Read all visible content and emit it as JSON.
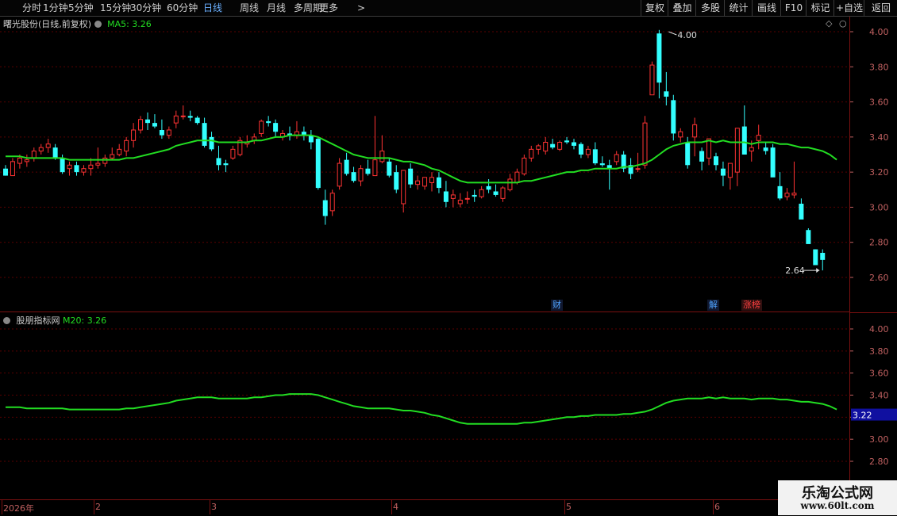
{
  "toolbar": {
    "periods": [
      "分时",
      "1分钟",
      "5分钟",
      "15分钟",
      "30分钟",
      "60分钟",
      "日线",
      "周线",
      "月线",
      "多周期",
      "更多"
    ],
    "active_period": "日线",
    "more_arrow": ">",
    "buttons": [
      "复权",
      "叠加",
      "多股",
      "统计",
      "画线",
      "F10",
      "标记",
      "+自选",
      "返回"
    ]
  },
  "main_header": {
    "title": "曙光股份(日线,前复权)",
    "ma_label": "MA5: 3.26"
  },
  "indicator_header": {
    "title": "股朋指标网",
    "ma_label": "M20: 3.26"
  },
  "annotations": {
    "high_label": "4.00",
    "low_label": "2.64",
    "current_value": "3.22"
  },
  "events": [
    {
      "text": "财",
      "color": "#4fa3ff",
      "bg": "#101830"
    },
    {
      "text": "解",
      "color": "#4fa3ff",
      "bg": "#101830"
    },
    {
      "text": "涨榜",
      "color": "#ff4040",
      "bg": "#301010"
    }
  ],
  "time_axis": [
    "2026年",
    "2",
    "3",
    "4",
    "5",
    "6"
  ],
  "watermark": {
    "name": "乐淘公式网",
    "url": "www.60lt.com"
  },
  "colors": {
    "up": "#ff3333",
    "down": "#33ffff",
    "ma": "#22dd22",
    "grid": "#5a0000"
  },
  "chart_data": [
    {
      "type": "candlestick",
      "title": "曙光股份(日线,前复权)",
      "y_ticks": [
        "4.00",
        "3.80",
        "3.60",
        "3.40",
        "3.20",
        "3.00",
        "2.80",
        "2.60"
      ],
      "ylim": [
        2.52,
        4.06
      ],
      "candles": [
        [
          3.22,
          3.24,
          3.18,
          3.18
        ],
        [
          3.18,
          3.28,
          3.18,
          3.26
        ],
        [
          3.25,
          3.3,
          3.22,
          3.28
        ],
        [
          3.26,
          3.3,
          3.23,
          3.27
        ],
        [
          3.28,
          3.34,
          3.26,
          3.32
        ],
        [
          3.32,
          3.36,
          3.3,
          3.34
        ],
        [
          3.34,
          3.39,
          3.31,
          3.36
        ],
        [
          3.34,
          3.36,
          3.27,
          3.28
        ],
        [
          3.28,
          3.3,
          3.19,
          3.2
        ],
        [
          3.22,
          3.26,
          3.18,
          3.24
        ],
        [
          3.24,
          3.26,
          3.18,
          3.2
        ],
        [
          3.2,
          3.24,
          3.18,
          3.22
        ],
        [
          3.22,
          3.28,
          3.18,
          3.24
        ],
        [
          3.24,
          3.34,
          3.22,
          3.25
        ],
        [
          3.25,
          3.3,
          3.23,
          3.28
        ],
        [
          3.28,
          3.34,
          3.27,
          3.3
        ],
        [
          3.3,
          3.36,
          3.29,
          3.33
        ],
        [
          3.32,
          3.4,
          3.29,
          3.38
        ],
        [
          3.38,
          3.48,
          3.34,
          3.44
        ],
        [
          3.44,
          3.52,
          3.42,
          3.5
        ],
        [
          3.5,
          3.54,
          3.44,
          3.48
        ],
        [
          3.48,
          3.53,
          3.45,
          3.46
        ],
        [
          3.44,
          3.5,
          3.39,
          3.41
        ],
        [
          3.41,
          3.46,
          3.39,
          3.44
        ],
        [
          3.48,
          3.55,
          3.45,
          3.52
        ],
        [
          3.52,
          3.58,
          3.5,
          3.52
        ],
        [
          3.52,
          3.55,
          3.49,
          3.51
        ],
        [
          3.51,
          3.52,
          3.47,
          3.48
        ],
        [
          3.48,
          3.51,
          3.34,
          3.35
        ],
        [
          3.4,
          3.43,
          3.32,
          3.33
        ],
        [
          3.28,
          3.35,
          3.21,
          3.24
        ],
        [
          3.25,
          3.27,
          3.2,
          3.24
        ],
        [
          3.28,
          3.35,
          3.27,
          3.33
        ],
        [
          3.3,
          3.4,
          3.29,
          3.38
        ],
        [
          3.36,
          3.41,
          3.34,
          3.37
        ],
        [
          3.38,
          3.42,
          3.36,
          3.4
        ],
        [
          3.42,
          3.5,
          3.4,
          3.49
        ],
        [
          3.49,
          3.52,
          3.46,
          3.48
        ],
        [
          3.48,
          3.5,
          3.4,
          3.43
        ],
        [
          3.4,
          3.44,
          3.38,
          3.42
        ],
        [
          3.42,
          3.46,
          3.38,
          3.41
        ],
        [
          3.41,
          3.49,
          3.39,
          3.43
        ],
        [
          3.43,
          3.46,
          3.38,
          3.41
        ],
        [
          3.41,
          3.44,
          3.33,
          3.37
        ],
        [
          3.39,
          3.4,
          3.1,
          3.11
        ],
        [
          3.04,
          3.1,
          2.9,
          2.95
        ],
        [
          2.98,
          3.1,
          2.95,
          3.08
        ],
        [
          3.12,
          3.28,
          3.1,
          3.25
        ],
        [
          3.27,
          3.31,
          3.18,
          3.19
        ],
        [
          3.2,
          3.23,
          3.14,
          3.15
        ],
        [
          3.15,
          3.24,
          3.12,
          3.22
        ],
        [
          3.22,
          3.27,
          3.18,
          3.19
        ],
        [
          3.18,
          3.52,
          3.18,
          3.27
        ],
        [
          3.26,
          3.41,
          3.25,
          3.32
        ],
        [
          3.26,
          3.28,
          3.17,
          3.18
        ],
        [
          3.2,
          3.24,
          3.08,
          3.1
        ],
        [
          3.02,
          3.2,
          2.97,
          3.21
        ],
        [
          3.22,
          3.25,
          3.11,
          3.13
        ],
        [
          3.13,
          3.18,
          3.1,
          3.15
        ],
        [
          3.12,
          3.16,
          3.1,
          3.17
        ],
        [
          3.14,
          3.2,
          3.09,
          3.17
        ],
        [
          3.17,
          3.2,
          3.08,
          3.11
        ],
        [
          3.09,
          3.15,
          3.0,
          3.03
        ],
        [
          3.05,
          3.1,
          3.0,
          3.07
        ],
        [
          3.02,
          3.08,
          3.0,
          3.04
        ],
        [
          3.05,
          3.09,
          3.02,
          3.05
        ],
        [
          3.07,
          3.1,
          3.03,
          3.06
        ],
        [
          3.06,
          3.12,
          3.05,
          3.1
        ],
        [
          3.12,
          3.16,
          3.08,
          3.1
        ],
        [
          3.09,
          3.13,
          3.06,
          3.07
        ],
        [
          3.05,
          3.12,
          3.03,
          3.11
        ],
        [
          3.1,
          3.19,
          3.09,
          3.16
        ],
        [
          3.14,
          3.22,
          3.13,
          3.2
        ],
        [
          3.19,
          3.3,
          3.18,
          3.28
        ],
        [
          3.28,
          3.35,
          3.26,
          3.33
        ],
        [
          3.33,
          3.36,
          3.3,
          3.35
        ],
        [
          3.32,
          3.4,
          3.3,
          3.37
        ],
        [
          3.36,
          3.39,
          3.33,
          3.34
        ],
        [
          3.33,
          3.38,
          3.32,
          3.37
        ],
        [
          3.38,
          3.4,
          3.36,
          3.37
        ],
        [
          3.37,
          3.39,
          3.33,
          3.35
        ],
        [
          3.36,
          3.37,
          3.28,
          3.3
        ],
        [
          3.3,
          3.35,
          3.28,
          3.33
        ],
        [
          3.33,
          3.37,
          3.24,
          3.25
        ],
        [
          3.25,
          3.29,
          3.23,
          3.24
        ],
        [
          3.24,
          3.27,
          3.1,
          3.22
        ],
        [
          3.26,
          3.32,
          3.24,
          3.3
        ],
        [
          3.3,
          3.32,
          3.2,
          3.22
        ],
        [
          3.24,
          3.28,
          3.16,
          3.19
        ],
        [
          3.22,
          3.31,
          3.2,
          3.22
        ],
        [
          3.24,
          3.52,
          3.22,
          3.48
        ],
        [
          3.64,
          3.83,
          3.64,
          3.81
        ],
        [
          3.99,
          4.01,
          3.62,
          3.71
        ],
        [
          3.66,
          3.77,
          3.58,
          3.63
        ],
        [
          3.61,
          3.64,
          3.38,
          3.42
        ],
        [
          3.4,
          3.45,
          3.37,
          3.43
        ],
        [
          3.37,
          3.4,
          3.22,
          3.24
        ],
        [
          3.4,
          3.51,
          3.29,
          3.47
        ],
        [
          3.32,
          3.34,
          3.21,
          3.26
        ],
        [
          3.28,
          3.38,
          3.24,
          3.39
        ],
        [
          3.29,
          3.31,
          3.21,
          3.24
        ],
        [
          3.22,
          3.26,
          3.12,
          3.18
        ],
        [
          3.17,
          3.25,
          3.1,
          3.25
        ],
        [
          3.2,
          3.41,
          3.12,
          3.45
        ],
        [
          3.46,
          3.58,
          3.42,
          3.3
        ],
        [
          3.32,
          3.38,
          3.26,
          3.34
        ],
        [
          3.38,
          3.47,
          3.33,
          3.41
        ],
        [
          3.34,
          3.37,
          3.3,
          3.32
        ],
        [
          3.34,
          3.36,
          3.2,
          3.17
        ],
        [
          3.12,
          3.2,
          3.04,
          3.05
        ],
        [
          3.06,
          3.11,
          3.04,
          3.08
        ],
        [
          3.07,
          3.26,
          3.05,
          3.08
        ],
        [
          3.02,
          3.05,
          2.95,
          2.93
        ],
        [
          2.87,
          2.88,
          2.84,
          2.79
        ],
        [
          2.76,
          2.76,
          2.7,
          2.67
        ],
        [
          2.74,
          2.76,
          2.64,
          2.7
        ]
      ],
      "ma": {
        "name": "MA5",
        "values": [
          3.29,
          3.29,
          3.29,
          3.28,
          3.28,
          3.28,
          3.28,
          3.28,
          3.28,
          3.27,
          3.27,
          3.27,
          3.27,
          3.27,
          3.27,
          3.27,
          3.27,
          3.28,
          3.28,
          3.29,
          3.3,
          3.31,
          3.32,
          3.33,
          3.35,
          3.36,
          3.37,
          3.38,
          3.38,
          3.38,
          3.37,
          3.37,
          3.37,
          3.37,
          3.37,
          3.38,
          3.38,
          3.39,
          3.4,
          3.4,
          3.41,
          3.41,
          3.41,
          3.41,
          3.4,
          3.38,
          3.36,
          3.34,
          3.32,
          3.3,
          3.29,
          3.28,
          3.28,
          3.28,
          3.28,
          3.27,
          3.26,
          3.26,
          3.25,
          3.24,
          3.22,
          3.21,
          3.19,
          3.17,
          3.15,
          3.14,
          3.14,
          3.14,
          3.14,
          3.14,
          3.14,
          3.14,
          3.14,
          3.15,
          3.15,
          3.16,
          3.17,
          3.18,
          3.19,
          3.2,
          3.2,
          3.21,
          3.21,
          3.22,
          3.22,
          3.22,
          3.22,
          3.23,
          3.23,
          3.24,
          3.25,
          3.27,
          3.3,
          3.33,
          3.35,
          3.36,
          3.37,
          3.37,
          3.37,
          3.38,
          3.37,
          3.38,
          3.37,
          3.37,
          3.37,
          3.36,
          3.37,
          3.37,
          3.37,
          3.36,
          3.36,
          3.35,
          3.34,
          3.34,
          3.33,
          3.32,
          3.3,
          3.27
        ]
      },
      "annotations": [
        "4.00",
        "2.64"
      ]
    },
    {
      "type": "line",
      "title": "股朋指标网",
      "y_ticks": [
        "4.00",
        "3.80",
        "3.60",
        "3.40",
        "3.20",
        "3.00",
        "2.80"
      ],
      "ylim": [
        2.7,
        4.1
      ],
      "series": [
        {
          "name": "M20",
          "values": [
            3.29,
            3.29,
            3.29,
            3.28,
            3.28,
            3.28,
            3.28,
            3.28,
            3.28,
            3.27,
            3.27,
            3.27,
            3.27,
            3.27,
            3.27,
            3.27,
            3.27,
            3.28,
            3.28,
            3.29,
            3.3,
            3.31,
            3.32,
            3.33,
            3.35,
            3.36,
            3.37,
            3.38,
            3.38,
            3.38,
            3.37,
            3.37,
            3.37,
            3.37,
            3.37,
            3.38,
            3.38,
            3.39,
            3.4,
            3.4,
            3.41,
            3.41,
            3.41,
            3.41,
            3.4,
            3.38,
            3.36,
            3.34,
            3.32,
            3.3,
            3.29,
            3.28,
            3.28,
            3.28,
            3.28,
            3.27,
            3.26,
            3.26,
            3.25,
            3.24,
            3.22,
            3.21,
            3.19,
            3.17,
            3.15,
            3.14,
            3.14,
            3.14,
            3.14,
            3.14,
            3.14,
            3.14,
            3.14,
            3.15,
            3.15,
            3.16,
            3.17,
            3.18,
            3.19,
            3.2,
            3.2,
            3.21,
            3.21,
            3.22,
            3.22,
            3.22,
            3.22,
            3.23,
            3.23,
            3.24,
            3.25,
            3.27,
            3.3,
            3.33,
            3.35,
            3.36,
            3.37,
            3.37,
            3.37,
            3.38,
            3.37,
            3.38,
            3.37,
            3.37,
            3.37,
            3.36,
            3.37,
            3.37,
            3.37,
            3.36,
            3.36,
            3.35,
            3.34,
            3.34,
            3.33,
            3.32,
            3.3,
            3.27
          ]
        }
      ],
      "annotations": [
        "3.22"
      ]
    }
  ]
}
